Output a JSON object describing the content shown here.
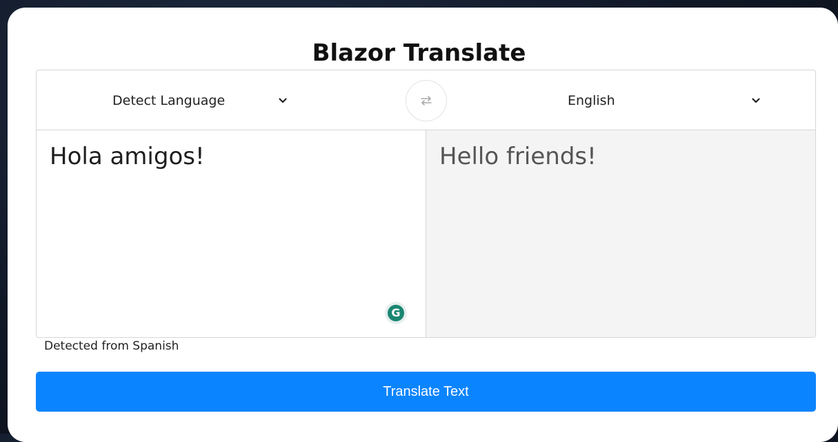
{
  "app": {
    "title": "Blazor Translate"
  },
  "source_language": {
    "selected": "Detect Language"
  },
  "target_language": {
    "selected": "English"
  },
  "swap_button": {
    "icon": "swap-arrows-icon"
  },
  "source_text": {
    "value": "Hola amigos!"
  },
  "translated_text": {
    "value": "Hello friends!"
  },
  "grammarly": {
    "letter": "G",
    "icon": "grammarly-icon",
    "color": "#1a8672"
  },
  "detection": {
    "text": "Detected from Spanish"
  },
  "actions": {
    "translate_label": "Translate Text",
    "accent_color": "#0b84ff"
  }
}
